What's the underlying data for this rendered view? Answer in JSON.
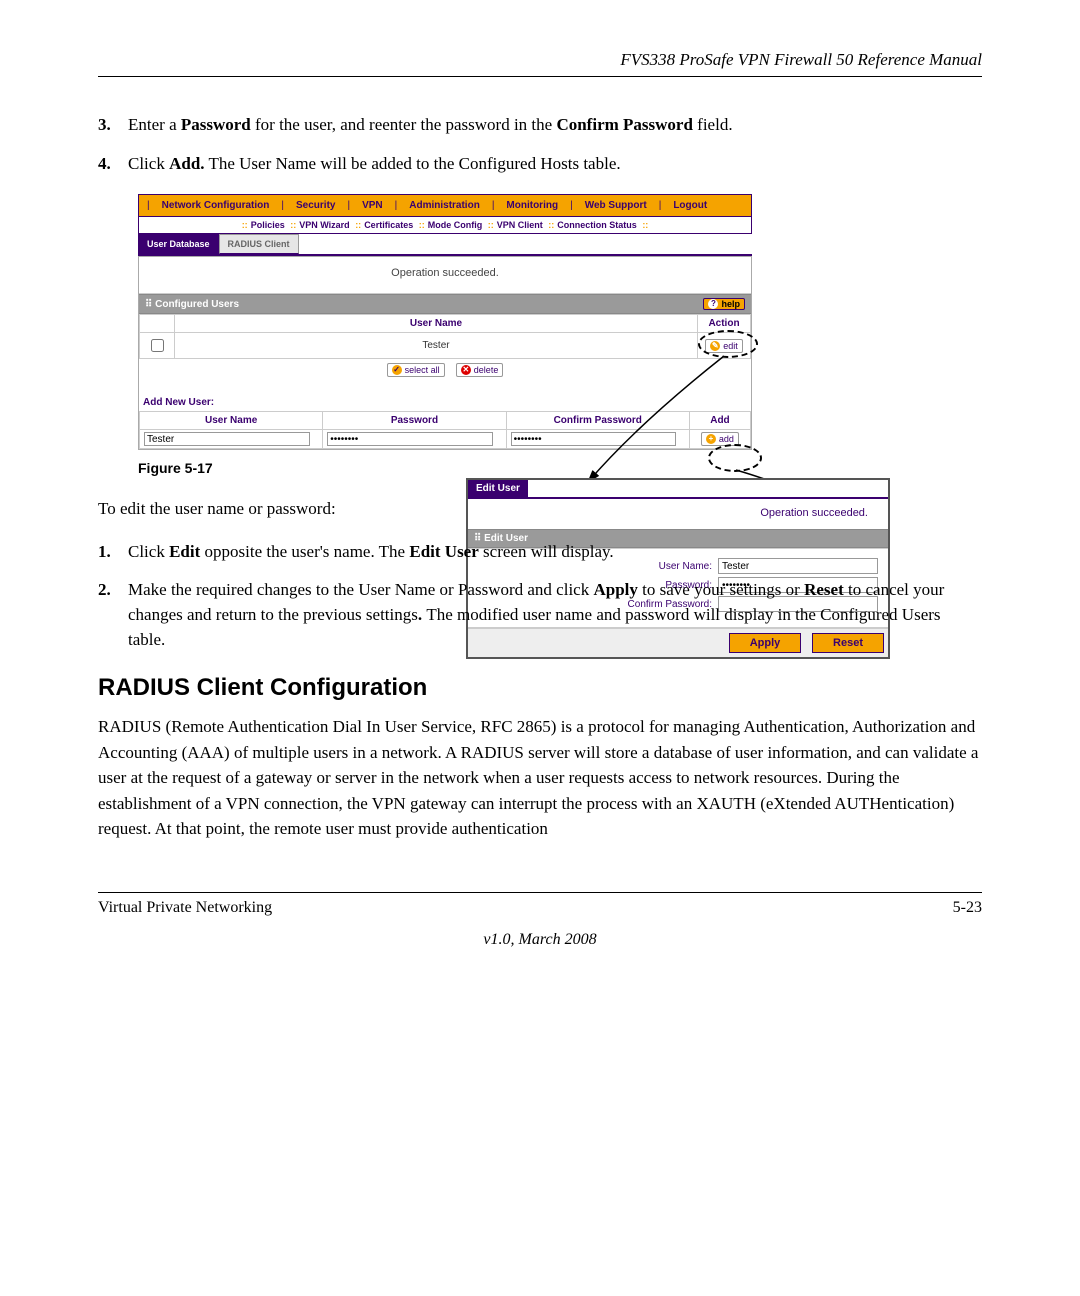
{
  "doc": {
    "header_title": "FVS338 ProSafe VPN Firewall 50 Reference Manual",
    "step3": "Enter a Password for the user, and reenter the password in the Confirm Password field.",
    "step4_a": "Click ",
    "step4_b": "Add.",
    "step4_c": " The User Name will be added to the Configured Hosts table.",
    "figure_caption": "Figure 5-17",
    "edit_intro": "To edit the user name or password:",
    "editstep1_a": "Click ",
    "editstep1_b": "Edit",
    "editstep1_c": " opposite the user's name. The ",
    "editstep1_d": "Edit User",
    "editstep1_e": " screen will display.",
    "editstep2_a": "Make the required changes to the User Name or Password and click ",
    "editstep2_b": "Apply",
    "editstep2_c": " to save your settings or ",
    "editstep2_d": "Reset",
    "editstep2_e": " to cancel your changes and return to the previous settings",
    "editstep2_f": ". ",
    "editstep2_g": "The modified user name and password will display in the Configured Users table.",
    "h2": "RADIUS Client Configuration",
    "radius_para": "RADIUS (Remote Authentication Dial In User Service, RFC 2865) is a protocol for managing Authentication, Authorization and Accounting (AAA) of multiple users in a network. A RADIUS server will store a database of user information, and can validate a user at the request of a gateway or server in the network when a user requests access to network resources. During the establishment of a VPN connection, the VPN gateway can interrupt the process with an XAUTH (eXtended AUTHentication) request. At that point, the remote user must provide authentication",
    "footer_left": "Virtual Private Networking",
    "footer_right": "5-23",
    "footer_ver": "v1.0, March 2008"
  },
  "ui": {
    "topnav": [
      "Network Configuration",
      "Security",
      "VPN",
      "Administration",
      "Monitoring",
      "Web Support",
      "Logout"
    ],
    "subnav": [
      "Policies",
      "VPN Wizard",
      "Certificates",
      "Mode Config",
      "VPN Client",
      "Connection Status"
    ],
    "tabs": {
      "active": "User Database",
      "other": "RADIUS Client"
    },
    "status": "Operation succeeded.",
    "section_title": "Configured Users",
    "help": "help",
    "col_user": "User Name",
    "col_action": "Action",
    "row_user": "Tester",
    "btn_edit": "edit",
    "btn_selectall": "select all",
    "btn_delete": "delete",
    "addnew": "Add New User:",
    "addcols": {
      "user": "User Name",
      "pass": "Password",
      "confirm": "Confirm Password",
      "add": "Add"
    },
    "addrow": {
      "user": "Tester",
      "pass": "••••••••",
      "confirm": "••••••••",
      "addbtn": "add"
    }
  },
  "editwin": {
    "tab": "Edit User",
    "ok": "Operation succeeded.",
    "bar": "Edit User",
    "lbl_user": "User Name:",
    "lbl_pass": "Password:",
    "lbl_conf": "Confirm Password:",
    "val_user": "Tester",
    "val_pass": "••••••••",
    "btn_apply": "Apply",
    "btn_reset": "Reset"
  }
}
